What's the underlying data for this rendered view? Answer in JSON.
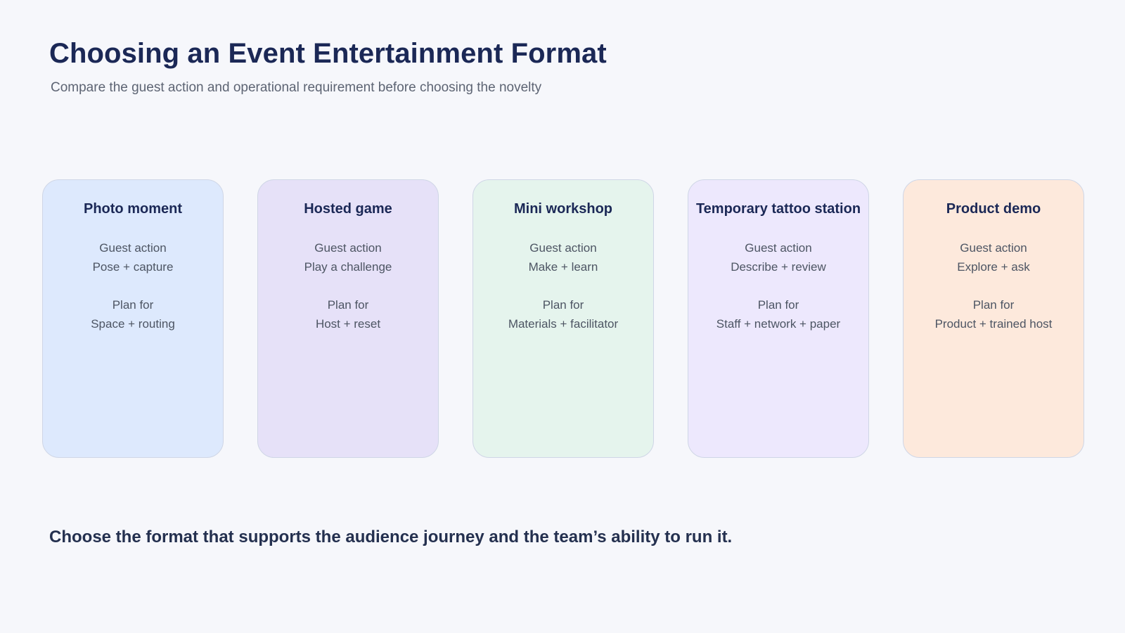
{
  "header": {
    "title": "Choosing an Event Entertainment Format",
    "subtitle": "Compare the guest action and operational requirement before choosing the novelty"
  },
  "cards": [
    {
      "title": "Photo moment",
      "action_label": "Guest action",
      "action_value": "Pose + capture",
      "plan_label": "Plan for",
      "plan_value": "Space + routing",
      "color": "#dde9fd"
    },
    {
      "title": "Hosted game",
      "action_label": "Guest action",
      "action_value": "Play a challenge",
      "plan_label": "Plan for",
      "plan_value": "Host + reset",
      "color": "#e6e1f8"
    },
    {
      "title": "Mini workshop",
      "action_label": "Guest action",
      "action_value": "Make + learn",
      "plan_label": "Plan for",
      "plan_value": "Materials + facilitator",
      "color": "#e5f4ed"
    },
    {
      "title": "Temporary tattoo station",
      "action_label": "Guest action",
      "action_value": "Describe + review",
      "plan_label": "Plan for",
      "plan_value": "Staff + network + paper",
      "color": "#ede8fd"
    },
    {
      "title": "Product demo",
      "action_label": "Guest action",
      "action_value": "Explore + ask",
      "plan_label": "Plan for",
      "plan_value": "Product + trained host",
      "color": "#fde9dc"
    }
  ],
  "footer": {
    "text": "Choose the format that supports the audience journey and the team’s ability to run it."
  }
}
